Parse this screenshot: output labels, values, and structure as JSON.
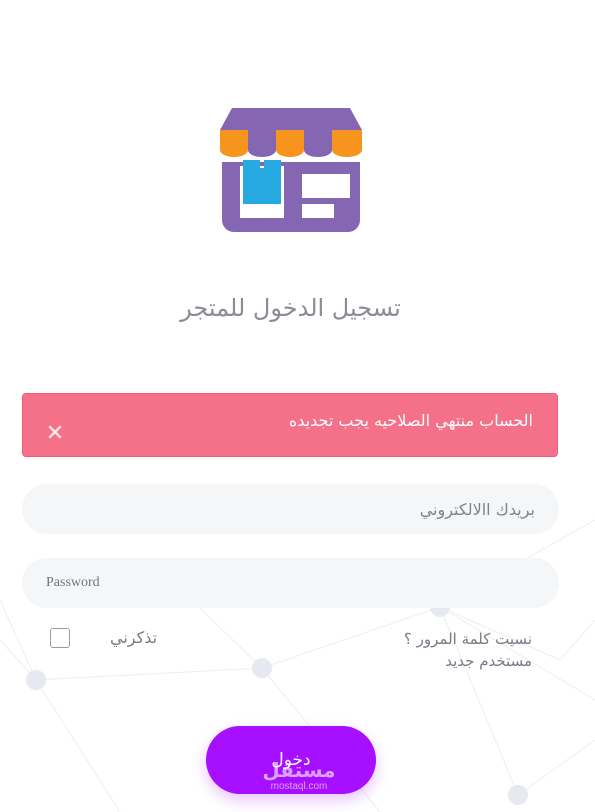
{
  "page": {
    "title": "تسجيل الدخول للمتجر"
  },
  "alert": {
    "message": "الحساب منتهي الصلاحيه يجب تجديده"
  },
  "form": {
    "email_placeholder": "بريدك االالكتروني",
    "password_placeholder": "Password",
    "remember_label": "تذكرني",
    "forgot_password_link": "نسيت كلمة المرور ؟",
    "new_user_link": "مستخدم جديد",
    "login_button": "دخول"
  },
  "watermark": {
    "brand": "مستقل",
    "domain": "mostaql.com"
  },
  "icons": {
    "logo": "store-icon",
    "alert_close": "close-icon"
  },
  "colors": {
    "alert_background": "#f57189",
    "login_button": "#a60fff",
    "logo_purple": "#8566b3",
    "logo_orange": "#f7941d",
    "logo_blue": "#27a9e1",
    "field_background": "#f5f6f8"
  }
}
